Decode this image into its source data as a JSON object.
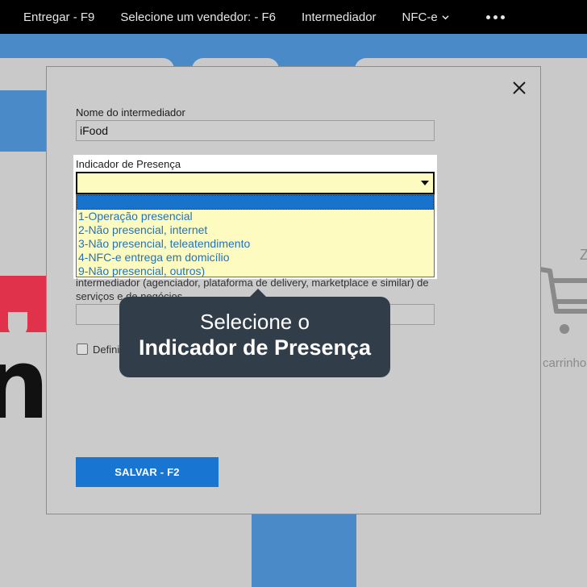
{
  "topbar": {
    "items": [
      {
        "label": "Entregar - F9"
      },
      {
        "label": "Selecione um vendedor: - F6"
      },
      {
        "label": "Intermediador"
      },
      {
        "label": "NFC-e"
      }
    ]
  },
  "background": {
    "z_text": "Z",
    "cart_text": "carrinho",
    "brand_text": "ne"
  },
  "modal": {
    "intermediary_name": {
      "label": "Nome do intermediador",
      "value": "iFood"
    },
    "presence": {
      "label": "Indicador de Presença",
      "value": "",
      "options": [
        {
          "label": ""
        },
        {
          "label": "1-Operação presencial"
        },
        {
          "label": "2-Não presencial, internet"
        },
        {
          "label": "3-Não presencial, teleatendimento"
        },
        {
          "label": "4-NFC-e entrega em domicílio"
        },
        {
          "label": "9-Não presencial, outros)"
        }
      ]
    },
    "description": "intermediador (agenciador, plataforma de delivery, marketplace e similar) de serviços e de negócios",
    "cnpj_field_value": "",
    "checkbox_label": "Definir",
    "save_label": "SALVAR - F2"
  },
  "tooltip": {
    "line1": "Selecione o",
    "line2": "Indicador de Presença"
  },
  "colors": {
    "accent_blue": "#1876d2",
    "topbar_bg": "#000000",
    "tooltip_bg": "#323d4a",
    "select_bg": "#fefbc1"
  }
}
